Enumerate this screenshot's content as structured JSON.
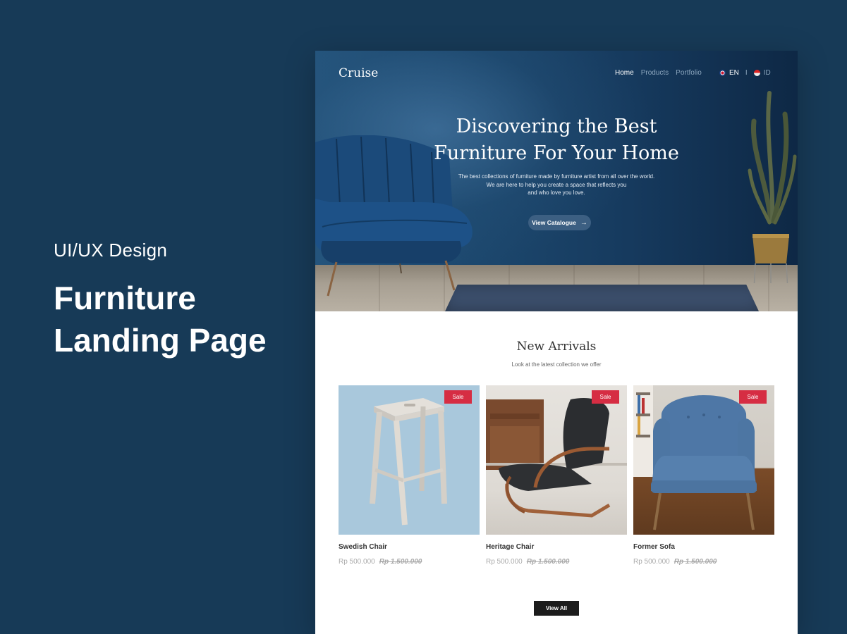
{
  "slide": {
    "subtitle": "UI/UX Design",
    "title_line1": "Furniture",
    "title_line2": "Landing Page"
  },
  "nav": {
    "logo": "Cruise",
    "links": [
      "Home",
      "Products",
      "Portfolio"
    ],
    "active_link": "Home",
    "lang_en": "EN",
    "separator": "I",
    "lang_id": "ID"
  },
  "hero": {
    "title_line1": "Discovering the Best",
    "title_line2": "Furniture For Your Home",
    "desc_line1": "The best collections of furniture made by furniture artist from all over the world.",
    "desc_line2": "We are here to help you create a space that reflects you",
    "desc_line3": "and who love you love.",
    "button_label": "View Catalogue"
  },
  "arrivals": {
    "title": "New Arrivals",
    "subtitle": "Look at the latest collection we offer",
    "products": [
      {
        "name": "Swedish Chair",
        "badge": "Sale",
        "price": "Rp 500.000",
        "old_price": "Rp 1.500.000"
      },
      {
        "name": "Heritage Chair",
        "badge": "Sale",
        "price": "Rp 500.000",
        "old_price": "Rp 1.500.000"
      },
      {
        "name": "Former Sofa",
        "badge": "Sale",
        "price": "Rp 500.000",
        "old_price": "Rp 1.500.000"
      }
    ],
    "view_all_label": "View All"
  },
  "colors": {
    "background": "#173a57",
    "sale_badge": "#d62d43",
    "hero_button": "#3c5f82",
    "dark_button": "#1c1c1c"
  }
}
